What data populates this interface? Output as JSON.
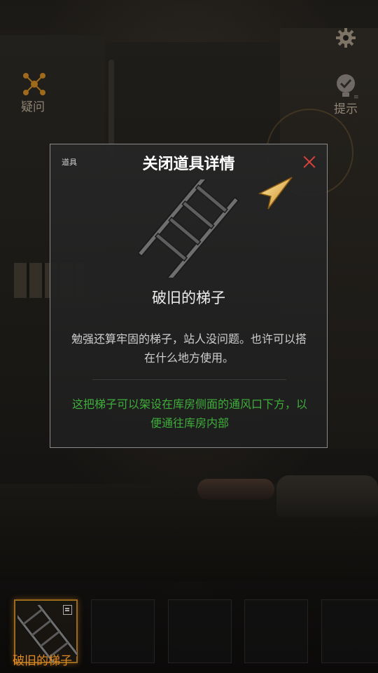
{
  "hud": {
    "settings_icon": "gear-icon",
    "doubt_label": "疑问",
    "hint_label": "提示"
  },
  "modal": {
    "tag": "道具",
    "title": "关闭道具详情",
    "item_name": "破旧的梯子",
    "description": "勉强还算牢固的梯子，站人没问题。也许可以搭在什么地方使用。",
    "clue": "这把梯子可以架设在库房侧面的通风口下方，以便通往库房内部",
    "colors": {
      "clue": "#3fae3b",
      "close": "#d9423a",
      "border": "#8a8a8a"
    }
  },
  "inventory": {
    "slots": [
      {
        "item": "破旧的梯子",
        "selected": true
      },
      {
        "item": "",
        "selected": false
      },
      {
        "item": "",
        "selected": false
      },
      {
        "item": "",
        "selected": false
      },
      {
        "item": "",
        "selected": false
      }
    ],
    "selected_label": "破旧的梯子",
    "accent": "#e08a24"
  }
}
